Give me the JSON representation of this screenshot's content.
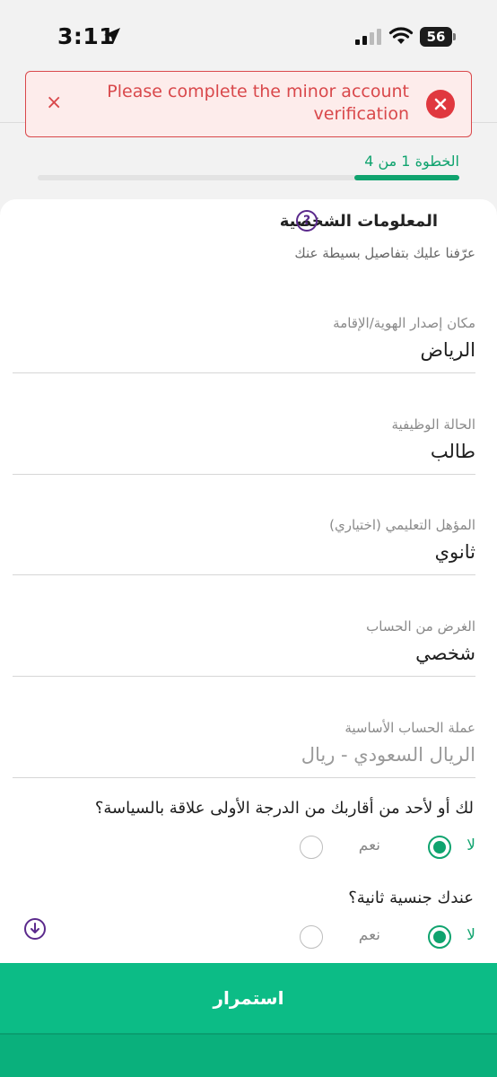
{
  "status_bar": {
    "time": "3:11",
    "battery": "56"
  },
  "banner": {
    "message": "Please complete the minor account verification",
    "close_glyph": "×",
    "icon": "error-x-icon"
  },
  "progress": {
    "step_label": "الخطوة 1 من 4",
    "current": 1,
    "total": 4
  },
  "section": {
    "title": "المعلومات الشخصية",
    "help_glyph": "?",
    "subtitle": "عرّفنا عليك بتفاصيل بسيطة عنك"
  },
  "fields": [
    {
      "label": "مكان إصدار الهوية/الإقامة",
      "value": "الرياض"
    },
    {
      "label": "الحالة الوظيفية",
      "value": "طالب"
    },
    {
      "label": "المؤهل التعليمي (اختياري)",
      "value": "ثانوي"
    },
    {
      "label": "الغرض من الحساب",
      "value": "شخصي"
    },
    {
      "label": "عملة الحساب الأساسية",
      "value": "الريال السعودي - ريال"
    }
  ],
  "questions": [
    {
      "text": "لك أو لأحد من أقاربك من الدرجة الأولى علاقة بالسياسة؟",
      "yes": "نعم",
      "no": "لا",
      "selected": "no"
    },
    {
      "text": "عندك جنسية ثانية؟",
      "yes": "نعم",
      "no": "لا",
      "selected": "no"
    }
  ],
  "continue_label": "استمرار",
  "colors": {
    "accent": "#0fa36e",
    "button": "#0cbc86",
    "error": "#d9484b",
    "help": "#5b2a8c"
  }
}
